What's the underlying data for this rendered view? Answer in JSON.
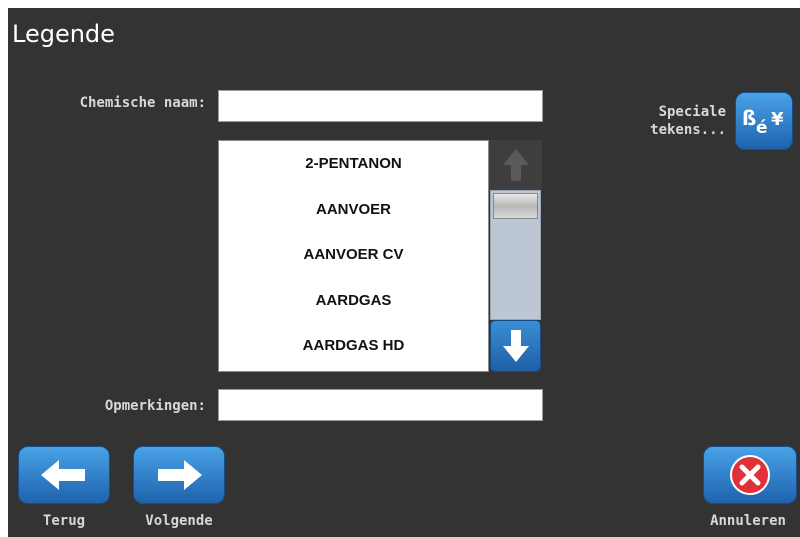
{
  "header": {
    "title": "Legende"
  },
  "form": {
    "chemical_name_label": "Chemische naam:",
    "chemical_name_value": "",
    "remarks_label": "Opmerkingen:",
    "remarks_value": ""
  },
  "list": {
    "items": [
      "2-PENTANON",
      "AANVOER",
      "AANVOER CV",
      "AARDGAS",
      "AARDGAS HD"
    ]
  },
  "special": {
    "label_line1": "Speciale",
    "label_line2": "tekens...",
    "icon_text": "ß é ¥"
  },
  "footer": {
    "back_label": "Terug",
    "next_label": "Volgende",
    "cancel_label": "Annuleren"
  },
  "colors": {
    "background": "#333333",
    "button_blue": "#2a7cc7",
    "cancel_red": "#e0303a"
  }
}
